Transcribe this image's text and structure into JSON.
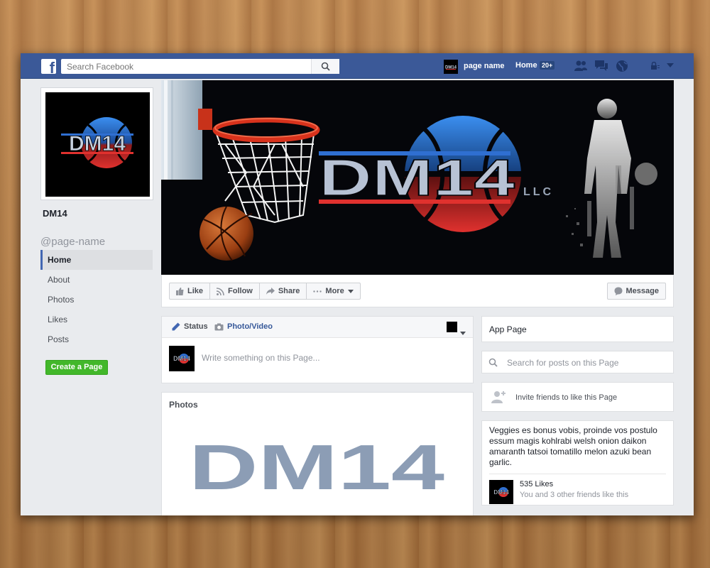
{
  "topbar": {
    "logo": "f",
    "search_placeholder": "Search Facebook",
    "page_name": "page name",
    "home_label": "Home",
    "home_badge": "20+"
  },
  "brand": {
    "logo_text": "DM14",
    "logo_suffix": "LLC",
    "colors": {
      "blue": "#3b5998",
      "red": "#e0312e",
      "ball_blue": "#2f7bd9",
      "steel": "#8c9db5",
      "green": "#42b72a"
    }
  },
  "sidebar": {
    "page_title": "DM14",
    "handle": "@page-name",
    "items": [
      {
        "label": "Home"
      },
      {
        "label": "About"
      },
      {
        "label": "Photos"
      },
      {
        "label": "Likes"
      },
      {
        "label": "Posts"
      }
    ],
    "create_page": "Create a Page"
  },
  "actions": {
    "like": "Like",
    "follow": "Follow",
    "share": "Share",
    "more": "More",
    "message": "Message"
  },
  "composer": {
    "status_tab": "Status",
    "photo_tab": "Photo/Video",
    "placeholder": "Write something on this Page..."
  },
  "photos": {
    "title": "Photos",
    "image_text": "DM14"
  },
  "right": {
    "app_page": "App Page",
    "search_placeholder": "Search for posts on this Page",
    "invite": "Invite friends to like this Page",
    "about": "Veggies es bonus vobis, proinde vos postulo essum magis kohlrabi welsh onion daikon amaranth tatsoi tomatillo melon azuki bean garlic.",
    "likes_count": "535 Likes",
    "likes_friends": "You and 3 other friends like this"
  },
  "icons": [
    "facebook-logo-icon",
    "search-icon",
    "friends-icon",
    "messages-icon",
    "globe-icon",
    "lock-icon",
    "chevron-down-icon",
    "like-icon",
    "follow-icon",
    "share-icon",
    "more-icon",
    "message-icon",
    "pencil-icon",
    "camera-icon",
    "add-friend-icon"
  ]
}
